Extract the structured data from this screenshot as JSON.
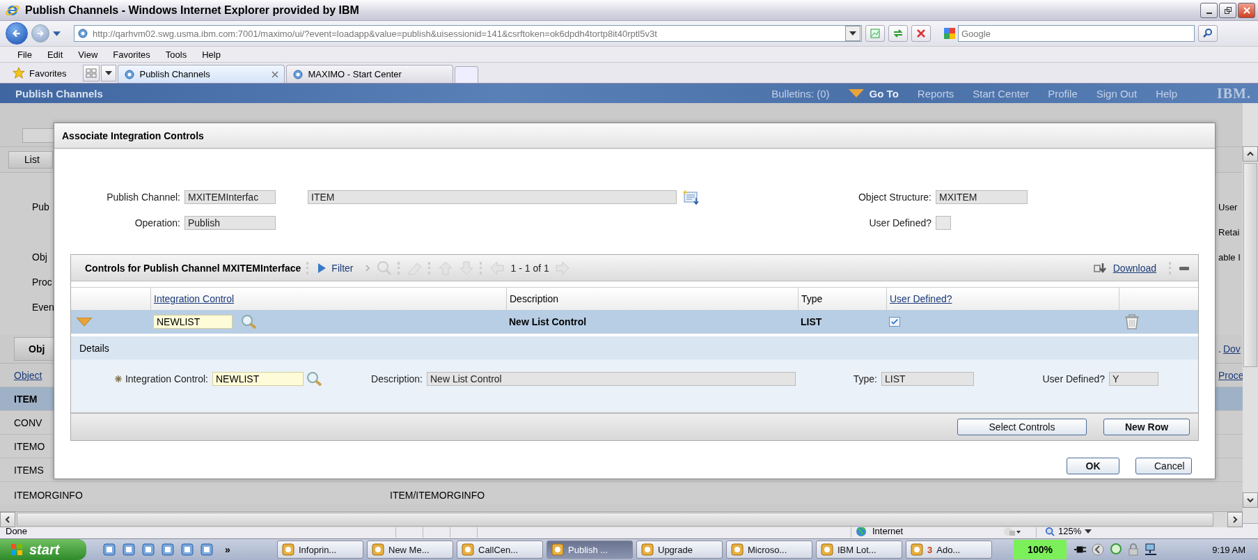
{
  "window": {
    "title": "Publish Channels - Windows Internet Explorer provided by IBM"
  },
  "address_bar": {
    "url": "http://qarhvm02.swg.usma.ibm.com:7001/maximo/ui/?event=loadapp&value=publish&uisessionid=141&csrftoken=ok6dpdh4tortp8it40rptl5v3t",
    "search_placeholder": "Google"
  },
  "menu": [
    "File",
    "Edit",
    "View",
    "Favorites",
    "Tools",
    "Help"
  ],
  "favorites": "Favorites",
  "tabs": [
    {
      "label": "Publish Channels",
      "selected": true
    },
    {
      "label": "MAXIMO - Start Center",
      "selected": false
    }
  ],
  "app_header": {
    "title": "Publish Channels",
    "links": [
      {
        "label": "Bulletins: (0)",
        "kind": "link"
      },
      {
        "label": "Go To",
        "kind": "menu"
      },
      {
        "label": "Reports",
        "kind": "link"
      },
      {
        "label": "Start Center",
        "kind": "link"
      },
      {
        "label": "Profile",
        "kind": "link"
      },
      {
        "label": "Sign Out",
        "kind": "link"
      },
      {
        "label": "Help",
        "kind": "link"
      }
    ],
    "logo": "IBM."
  },
  "background": {
    "tab": "List",
    "form_rows": [
      {
        "left": "Pub",
        "right": "User"
      },
      {
        "right": "Retai"
      },
      {
        "left": "Obj",
        "right": "able I"
      },
      {
        "left": "Proc"
      },
      {
        "left": "Even"
      }
    ],
    "section_tab": "Obj",
    "section_mark": ".",
    "section_link": "Dov",
    "columns": [
      "Object",
      "Proce"
    ],
    "rows": [
      {
        "cells": [
          "ITEM"
        ],
        "selected": true
      },
      {
        "cells": [
          "CONV"
        ],
        "selected": false
      },
      {
        "cells": [
          "ITEMO"
        ],
        "selected": false
      },
      {
        "cells": [
          "ITEMS"
        ],
        "selected": false
      },
      {
        "cells": [
          "ITEMORGINFO",
          "ITEM/ITEMORGINFO"
        ],
        "selected": false
      }
    ]
  },
  "dialog": {
    "title": "Associate Integration Controls",
    "publish_channel": {
      "label": "Publish Channel:",
      "value": "MXITEMInterfac",
      "description": "ITEM"
    },
    "operation": {
      "label": "Operation:",
      "value": "Publish"
    },
    "object_structure": {
      "label": "Object Structure:",
      "value": "MXITEM"
    },
    "user_defined": {
      "label": "User Defined?",
      "checked": false
    },
    "table": {
      "title": "Controls for Publish Channel MXITEMInterface",
      "filter": "Filter",
      "pagination": "1 - 1 of 1",
      "download": "Download",
      "columns": [
        {
          "label": "Integration Control",
          "link": true
        },
        {
          "label": "Description",
          "link": false
        },
        {
          "label": "Type",
          "link": false
        },
        {
          "label": "User Defined?",
          "link": true
        }
      ],
      "rows": [
        {
          "integration_control": "NEWLIST",
          "description": "New List Control",
          "type": "LIST",
          "user_defined": true,
          "expanded": true,
          "selected": true
        }
      ],
      "details": {
        "title": "Details",
        "fields": [
          {
            "label": "Integration Control:",
            "value": "NEWLIST",
            "kind": "lookup",
            "required": true
          },
          {
            "label": "Description:",
            "value": "New List Control",
            "kind": "readonly",
            "required": false
          },
          {
            "label": "Type:",
            "value": "LIST",
            "kind": "readonly",
            "required": false
          },
          {
            "label": "User Defined?",
            "value": "Y",
            "kind": "readonly",
            "required": false
          }
        ]
      },
      "buttons": [
        {
          "label": "Select Controls",
          "primary": false
        },
        {
          "label": "New Row",
          "primary": true
        }
      ]
    },
    "buttons": [
      {
        "label": "OK",
        "primary": true
      },
      {
        "label": "Cancel",
        "primary": false
      }
    ]
  },
  "status_bar": {
    "text": "Done",
    "zone": "Internet",
    "zoom": "125%"
  },
  "taskbar": {
    "start": "start",
    "overflow": "»",
    "tasks": [
      {
        "label": "Infoprin...",
        "selected": false
      },
      {
        "label": "New Me...",
        "selected": false
      },
      {
        "label": "CallCen...",
        "selected": false
      },
      {
        "label": "Publish ...",
        "selected": true
      },
      {
        "label": "Upgrade",
        "selected": false
      },
      {
        "label": "Microso...",
        "selected": false
      },
      {
        "label": "IBM Lot...",
        "selected": false
      },
      {
        "count": "3",
        "label": "Ado...",
        "selected": false
      }
    ],
    "battery": "100%",
    "clock": "9:19 AM"
  }
}
